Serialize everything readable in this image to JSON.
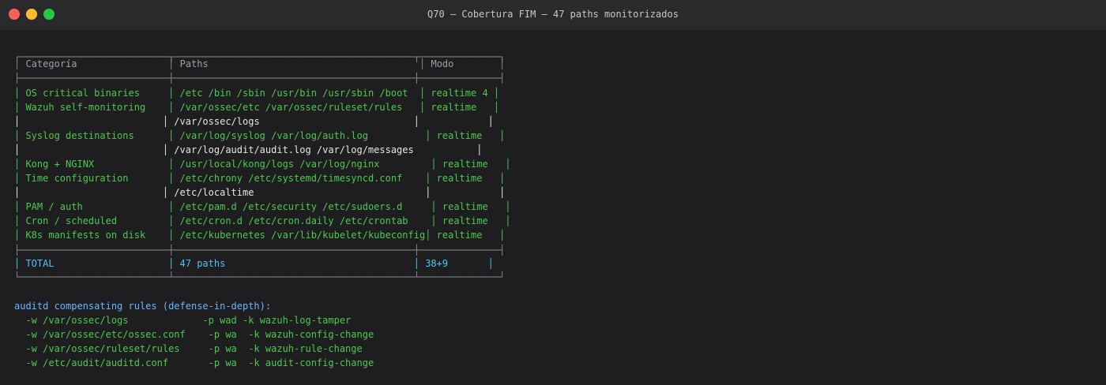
{
  "window": {
    "title": "Q70 — Cobertura FIM — 47 paths monitorizados",
    "buttons": [
      "close",
      "minimize",
      "maximize"
    ]
  },
  "table": {
    "headers": [
      "Categoría",
      "Paths",
      "Modo"
    ],
    "rows": [
      {
        "category": "OS critical binaries",
        "paths": "/etc /bin /sbin /usr/bin /usr/sbin /boot",
        "mode": "realtime 4"
      },
      {
        "category": "Wazuh self-monitoring",
        "paths": "/var/ossec/etc /var/ossec/ruleset/rules",
        "mode": "realtime"
      },
      {
        "category": "",
        "paths": "/var/ossec/logs",
        "mode": ""
      },
      {
        "category": "Syslog destinations",
        "paths": "/var/log/syslog /var/log/auth.log",
        "mode": "realtime"
      },
      {
        "category": "",
        "paths": "/var/log/audit/audit.log /var/log/messages",
        "mode": ""
      },
      {
        "category": "Kong + NGINX",
        "paths": "/usr/local/kong/logs /var/log/nginx",
        "mode": "realtime"
      },
      {
        "category": "Time configuration",
        "paths": "/etc/chrony /etc/systemd/timesyncd.conf",
        "mode": "realtime"
      },
      {
        "category": "",
        "paths": "/etc/localtime",
        "mode": ""
      },
      {
        "category": "PAM / auth",
        "paths": "/etc/pam.d /etc/security /etc/sudoers.d",
        "mode": "realtime"
      },
      {
        "category": "Cron / scheduled",
        "paths": "/etc/cron.d /etc/cron.daily /etc/crontab",
        "mode": "realtime"
      },
      {
        "category": "K8s manifests on disk",
        "paths": "/etc/kubernetes /var/lib/kubelet/kubeconfig",
        "mode": "realtime"
      }
    ],
    "total": {
      "category": "TOTAL",
      "paths": "47 paths",
      "mode": "38+9"
    }
  },
  "auditd": {
    "heading": "auditd compensating rules (defense-in-depth):",
    "rules": [
      {
        "watch": "-w /var/ossec/logs",
        "perm": "-p wad",
        "key": "-k wazuh-log-tamper"
      },
      {
        "watch": "-w /var/ossec/etc/ossec.conf",
        "perm": "-p wa",
        "key": "-k wazuh-config-change"
      },
      {
        "watch": "-w /var/ossec/ruleset/rules",
        "perm": "-p wa",
        "key": "-k wazuh-rule-change"
      },
      {
        "watch": "-w /etc/audit/auditd.conf",
        "perm": "-p wa",
        "key": "-k audit-config-change"
      }
    ]
  },
  "colors": {
    "green": "#4ec94e",
    "blue": "#6cb6ff",
    "border": "#8a8a8a",
    "background": "#1e1e20"
  }
}
